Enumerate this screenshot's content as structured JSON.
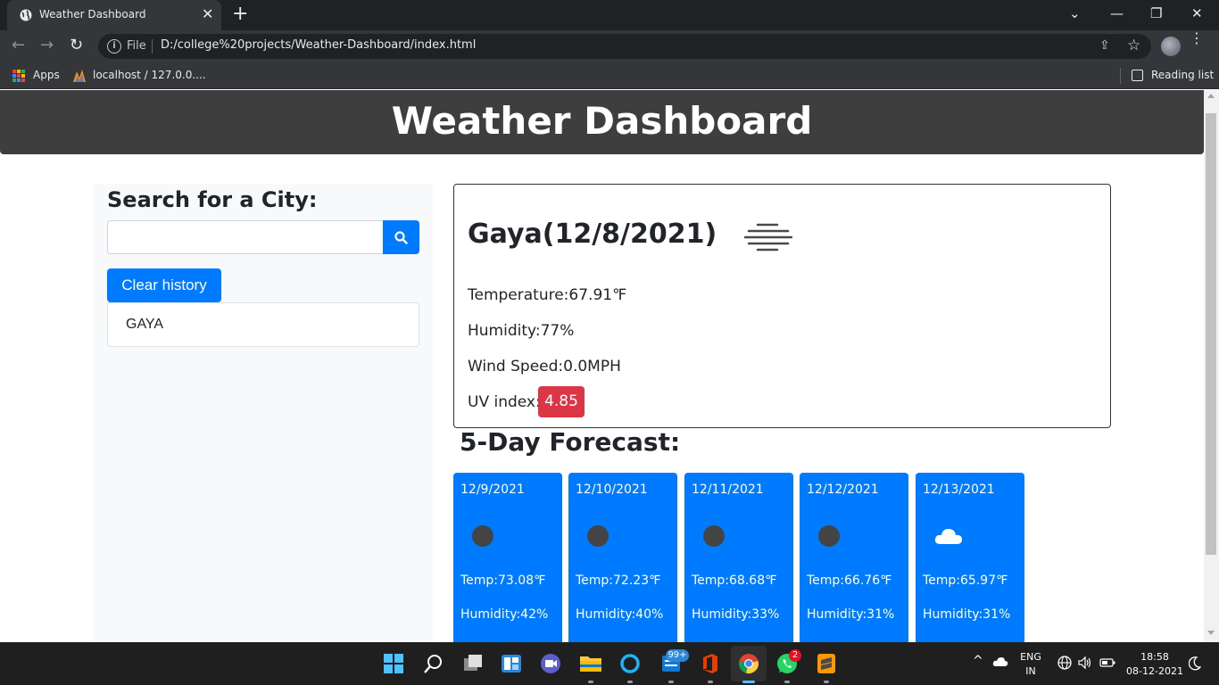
{
  "browser": {
    "tab_title": "Weather Dashboard",
    "tab_close": "✕",
    "new_tab": "+",
    "window_controls": {
      "minimize": "—",
      "maximize": "❐",
      "close": "✕",
      "dropdown": "⌄"
    },
    "nav": {
      "back": "←",
      "forward": "→",
      "reload": "↻"
    },
    "omnibox": {
      "scheme_label": "File",
      "url": "D:/college%20projects/Weather-Dashboard/index.html",
      "info_glyph": "i",
      "share": "⇪",
      "star": "☆",
      "menu": "⋮"
    },
    "bookmarks": [
      {
        "label": "Apps",
        "icon": "apps-grid-icon"
      },
      {
        "label": "localhost / 127.0.0....",
        "icon": "phpmyadmin-icon"
      }
    ],
    "reading_list": "Reading list",
    "apps_grid_colors": [
      "#ea4335",
      "#fbbc04",
      "#34a853",
      "#4285f4",
      "#ea4335",
      "#fbbc04",
      "#34a853",
      "#4285f4",
      "#ea4335"
    ]
  },
  "page": {
    "header_title": "Weather Dashboard",
    "search": {
      "heading": "Search for a City:",
      "input_value": "",
      "button_icon": "search-icon"
    },
    "clear_history_label": "Clear history",
    "history": [
      "GAYA"
    ],
    "current": {
      "city_date": "Gaya(12/8/2021)",
      "icon": "mist-icon",
      "temperature": "Temperature:67.91℉",
      "humidity": "Humidity:77%",
      "wind": "Wind Speed:0.0MPH",
      "uv_label": "UV index:",
      "uv_value": "4.85",
      "uv_color": "#dc3545"
    },
    "forecast_heading": "5-Day Forecast:",
    "forecast": [
      {
        "date": "12/9/2021",
        "icon": "clear-night-icon",
        "temp": "Temp:73.08℉",
        "humidity": "Humidity:42%"
      },
      {
        "date": "12/10/2021",
        "icon": "clear-night-icon",
        "temp": "Temp:72.23℉",
        "humidity": "Humidity:40%"
      },
      {
        "date": "12/11/2021",
        "icon": "clear-night-icon",
        "temp": "Temp:68.68℉",
        "humidity": "Humidity:33%"
      },
      {
        "date": "12/12/2021",
        "icon": "clear-night-icon",
        "temp": "Temp:66.76℉",
        "humidity": "Humidity:31%"
      },
      {
        "date": "12/13/2021",
        "icon": "cloud-icon",
        "temp": "Temp:65.97℉",
        "humidity": "Humidity:31%"
      }
    ],
    "accent_color": "#007bff",
    "header_color": "#3e3e3e"
  },
  "taskbar": {
    "apps": [
      "windows-start-icon",
      "search-icon",
      "task-view-icon",
      "widgets-icon",
      "teams-chat-icon",
      "file-explorer-icon",
      "cortana-icon",
      "mail-icon",
      "office-icon",
      "chrome-icon",
      "whatsapp-icon",
      "sublime-text-icon"
    ],
    "mail_badge": "99+",
    "whatsapp_badge": "2",
    "language_line1": "ENG",
    "language_line2": "IN",
    "time": "18:58",
    "date": "08-12-2021",
    "tray_chevron": "^"
  }
}
